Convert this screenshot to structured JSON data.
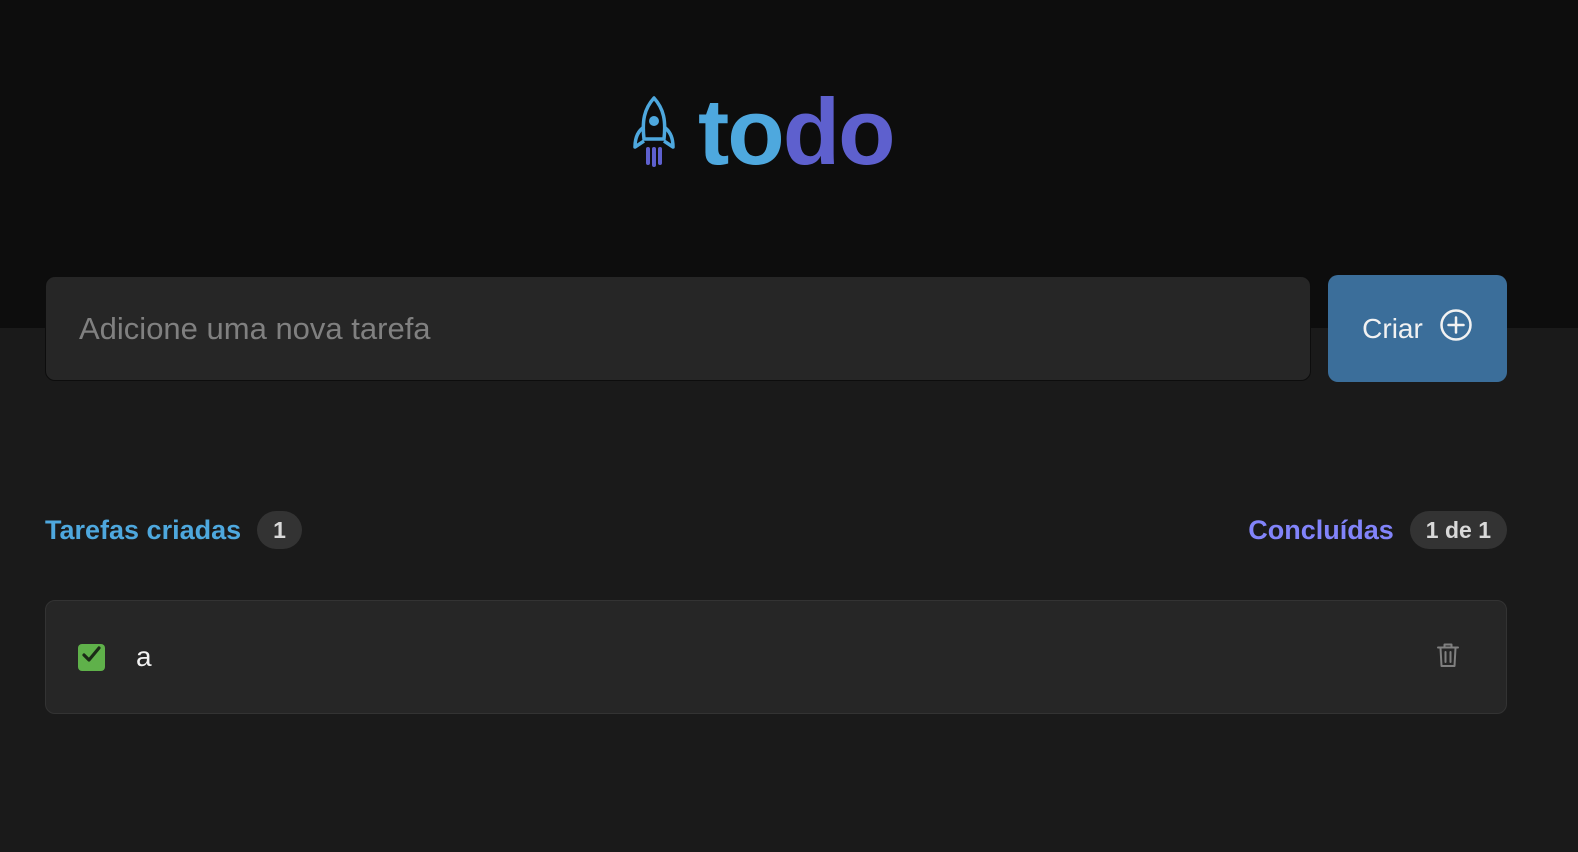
{
  "brand": {
    "name_part1": "to",
    "name_part2": "do",
    "icon": "rocket-icon",
    "colors": {
      "primary": "#4ea8de",
      "secondary": "#5e60ce"
    }
  },
  "new_task": {
    "placeholder": "Adicione uma nova tarefa",
    "value": ""
  },
  "create_button": {
    "label": "Criar",
    "icon": "plus-circle-icon",
    "color": "#3b6e9a"
  },
  "counters": {
    "created_label": "Tarefas criadas",
    "created_count": "1",
    "done_label": "Concluídas",
    "done_count": "1 de 1"
  },
  "tasks": [
    {
      "text": "a",
      "completed": true,
      "checkbox_icon": "check-icon",
      "delete_icon": "trash-icon"
    }
  ]
}
